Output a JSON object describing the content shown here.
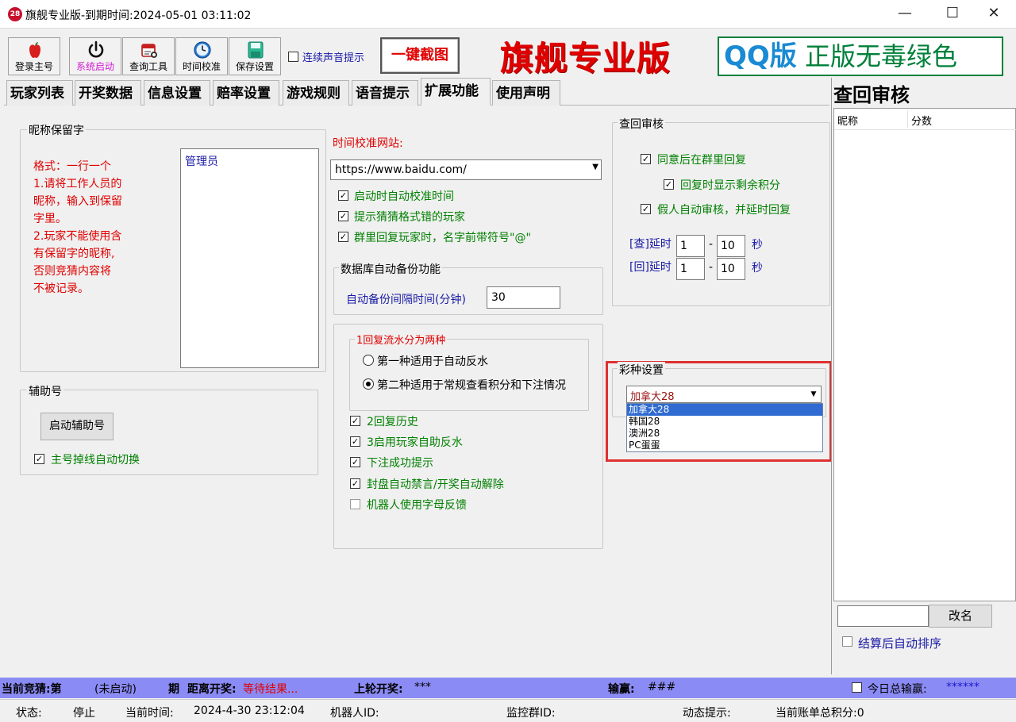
{
  "window": {
    "title": "旗舰专业版-到期时间:2024-05-01 03:11:02",
    "app_icon_text": "28",
    "minimize": "—",
    "maximize": "☐",
    "close": "✕"
  },
  "toolbar": {
    "buttons": [
      {
        "label": "登录主号",
        "icon": "apple-icon"
      },
      {
        "label": "系统启动",
        "icon": "power-icon"
      },
      {
        "label": "查询工具",
        "icon": "calendar-icon"
      },
      {
        "label": "时间校准",
        "icon": "clock-icon"
      },
      {
        "label": "保存设置",
        "icon": "save-icon"
      }
    ],
    "sound_label": "连续声音提示",
    "sound_checked": false,
    "screenshot_label": "一键截图",
    "brand_text": "旗舰专业版",
    "banner_qq": "QQ版",
    "banner_rest": " 正版无毒绿色"
  },
  "tabs": [
    "玩家列表",
    "开奖数据",
    "信息设置",
    "赔率设置",
    "游戏规则",
    "语音提示",
    "扩展功能",
    "使用声明"
  ],
  "nickname": {
    "title": "昵称保留字",
    "instructions": [
      "格式：一行一个",
      "1.请将工作人员的",
      "昵称，输入到保留",
      "字里。",
      "2.玩家不能使用含",
      "有保留字的昵称,",
      "否则竞猜内容将",
      "不被记录。"
    ],
    "textarea_value": "管理员"
  },
  "assist": {
    "title": "辅助号",
    "button": "启动辅助号",
    "auto_switch": "主号掉线自动切换",
    "auto_switch_checked": true
  },
  "time": {
    "label": "时间校准网站:",
    "url": "https://www.baidu.com/",
    "checks": [
      {
        "label": "启动时自动校准时间",
        "checked": true
      },
      {
        "label": "提示猜猜格式错的玩家",
        "checked": true
      },
      {
        "label": "群里回复玩家时，名字前带符号\"@\"",
        "checked": true
      }
    ]
  },
  "backup": {
    "title": "数据库自动备份功能",
    "label": "自动备份间隔时间(分钟)",
    "value": "30"
  },
  "reply": {
    "title": "1回复流水分为两种",
    "options": [
      {
        "label": "第一种适用于自动反水",
        "selected": false
      },
      {
        "label": "第二种适用于常规查看积分和下注情况",
        "selected": true
      }
    ],
    "checks": [
      {
        "label": "2回复历史",
        "checked": true
      },
      {
        "label": "3启用玩家自助反水",
        "checked": true
      },
      {
        "label": "下注成功提示",
        "checked": true
      },
      {
        "label": "封盘自动禁言/开奖自动解除",
        "checked": true
      },
      {
        "label": "机器人使用字母反馈",
        "checked": false
      }
    ]
  },
  "audit": {
    "title": "查回审核",
    "checks": [
      {
        "label": "同意后在群里回复",
        "checked": true
      },
      {
        "label": "回复时显示剩余积分",
        "checked": true
      },
      {
        "label": "假人自动审核，并延时回复",
        "checked": true
      }
    ],
    "delays": [
      {
        "label": "[查]延时",
        "from": "1",
        "to": "10",
        "unit": "秒",
        "sep": "-"
      },
      {
        "label": "[回]延时",
        "from": "1",
        "to": "10",
        "unit": "秒",
        "sep": "-"
      }
    ]
  },
  "lottery": {
    "title": "彩种设置",
    "selected": "加拿大28",
    "options": [
      "加拿大28",
      "韩国28",
      "澳洲28",
      "PC蛋蛋"
    ],
    "highlight_color": "#e03030"
  },
  "right_panel": {
    "title": "查回审核",
    "columns": [
      "昵称",
      "分数"
    ],
    "rename_button": "改名",
    "rename_value": "",
    "auto_sort": "结算后自动排序",
    "auto_sort_checked": false
  },
  "status": {
    "current_guess_label": "当前竞猜:第",
    "current_guess_value": "(未启动)",
    "period": "期",
    "countdown_label": "距离开奖:",
    "countdown_value": "等待结果...",
    "last_label": "上轮开奖:",
    "last_value": "***",
    "winloss_label": "输赢:",
    "winloss_value": "###",
    "today_label": "今日总输赢:",
    "today_value": "******",
    "state_label": "状态:",
    "state_value": "停止",
    "time_label": "当前时间:",
    "time_value": "2024-4-30 23:12:04",
    "robot_label": "机器人ID:",
    "monitor_label": "监控群ID:",
    "dynamic_label": "动态提示:",
    "total_label": "当前账单总积分:0"
  }
}
